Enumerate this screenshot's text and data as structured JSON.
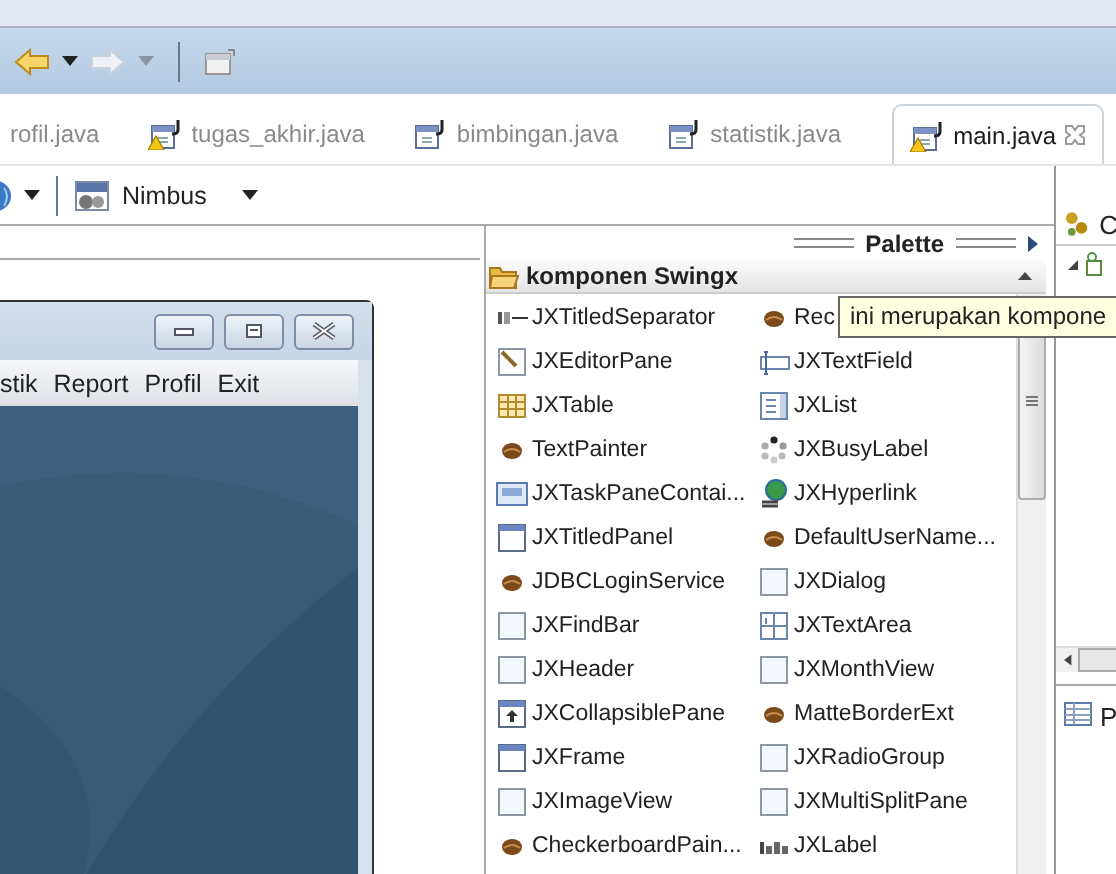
{
  "toolbar": {
    "buttons": [
      {
        "kind": "back",
        "disabled": false
      },
      {
        "kind": "forward",
        "disabled": true
      }
    ]
  },
  "tabs": [
    {
      "label": "rofil.java",
      "selected": false,
      "icon": false,
      "warning": false
    },
    {
      "label": "tugas_akhir.java",
      "selected": false,
      "icon": true,
      "warning": true
    },
    {
      "label": "bimbingan.java",
      "selected": false,
      "icon": true,
      "warning": false
    },
    {
      "label": "statistik.java",
      "selected": false,
      "icon": true,
      "warning": false
    },
    {
      "label": "main.java",
      "selected": true,
      "icon": true,
      "warning": true
    }
  ],
  "designer_toolbar": {
    "look_and_feel": "Nimbus"
  },
  "preview_frame": {
    "menus": [
      "stik",
      "Report",
      "Profil",
      "Exit"
    ]
  },
  "palette": {
    "title": "Palette",
    "category": "komponen Swingx",
    "items": [
      {
        "label": "JXTitledSeparator",
        "kind": "separator"
      },
      {
        "label": "Rec",
        "kind": "bean"
      },
      {
        "label": "JXEditorPane",
        "kind": "editor"
      },
      {
        "label": "JXTextField",
        "kind": "textfield"
      },
      {
        "label": "JXTable",
        "kind": "table"
      },
      {
        "label": "JXList",
        "kind": "list"
      },
      {
        "label": "TextPainter",
        "kind": "bean"
      },
      {
        "label": "JXBusyLabel",
        "kind": "busy"
      },
      {
        "label": "JXTaskPaneContai...",
        "kind": "taskpane"
      },
      {
        "label": "JXHyperlink",
        "kind": "hyperlink"
      },
      {
        "label": "JXTitledPanel",
        "kind": "frame"
      },
      {
        "label": "DefaultUserName...",
        "kind": "bean"
      },
      {
        "label": "JDBCLoginService",
        "kind": "bean"
      },
      {
        "label": "JXDialog",
        "kind": "blank"
      },
      {
        "label": "JXFindBar",
        "kind": "blank"
      },
      {
        "label": "JXTextArea",
        "kind": "textarea"
      },
      {
        "label": "JXHeader",
        "kind": "blank"
      },
      {
        "label": "JXMonthView",
        "kind": "blank"
      },
      {
        "label": "JXCollapsiblePane",
        "kind": "collapsible"
      },
      {
        "label": "MatteBorderExt",
        "kind": "bean"
      },
      {
        "label": "JXFrame",
        "kind": "frame"
      },
      {
        "label": "JXRadioGroup",
        "kind": "blank"
      },
      {
        "label": "JXImageView",
        "kind": "blank"
      },
      {
        "label": "JXMultiSplitPane",
        "kind": "blank"
      },
      {
        "label": "CheckerboardPain...",
        "kind": "bean"
      },
      {
        "label": "JXLabel",
        "kind": "label"
      }
    ]
  },
  "tooltip": {
    "text": "ini merupakan kompone"
  },
  "navigator": {
    "title": "C"
  },
  "properties": {
    "title": "P"
  }
}
